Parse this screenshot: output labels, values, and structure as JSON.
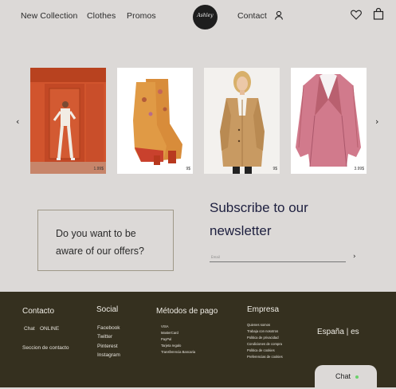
{
  "nav": {
    "new_collection": "New Collection",
    "clothes": "Clothes",
    "promos": "Promos",
    "contact": "Contact",
    "logo_text": "Ashley"
  },
  "carousel": {
    "prev": "‹",
    "next": "›",
    "items": [
      {
        "price": "1.99$"
      },
      {
        "price": "9$"
      },
      {
        "price": "9$"
      },
      {
        "price": "3.99$"
      }
    ]
  },
  "offer": {
    "line1": "Do you want to be",
    "line2": "aware of our offers?"
  },
  "newsletter": {
    "line1": "Subscribe to our",
    "line2": "newsletter",
    "email_placeholder": "Email",
    "send": "›"
  },
  "footer": {
    "contacto": {
      "title": "Contacto",
      "chat": "Chat",
      "online": "ONLINE",
      "section": "Seccion de contacto"
    },
    "social": {
      "title": "Social",
      "items": [
        "Facebook",
        "Twitter",
        "Pinterest",
        "Instagram"
      ]
    },
    "pago": {
      "title": "Métodos de pago",
      "items": [
        "VISA",
        "MasterCard",
        "PayPal",
        "Tarjeta regalo",
        "Transferencia Bancaria"
      ]
    },
    "empresa": {
      "title": "Empresa",
      "items": [
        "Quienes somos",
        "Trabaja con nosotros",
        "Politica de privacidad",
        "Condiciones de compra",
        "Politica de cookies",
        "Preferencias de cookies"
      ]
    },
    "region": "España | es"
  },
  "chat_button": {
    "label": "Chat"
  },
  "colors": {
    "footer_bg": "#35301f",
    "page_bg": "#dcd9d7",
    "accent_text": "#1d1f3f",
    "online_dot": "#6bd16b"
  }
}
